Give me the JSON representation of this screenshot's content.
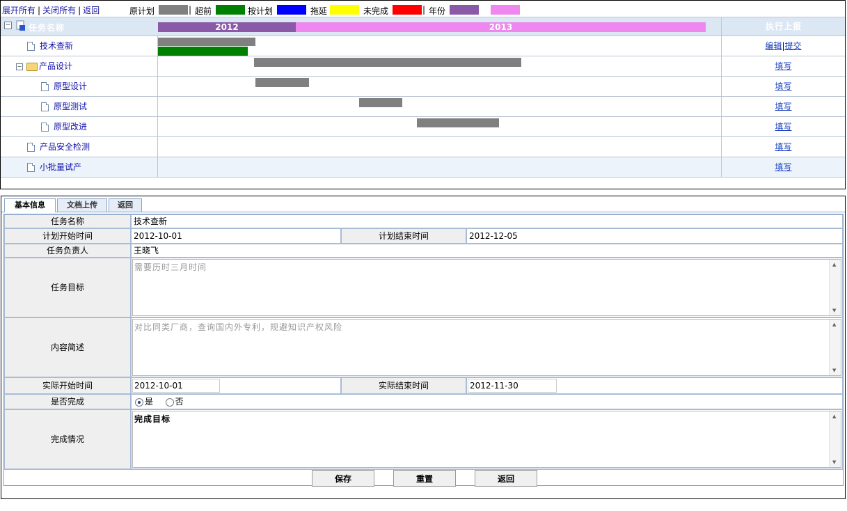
{
  "toolbar": {
    "expand_all": "展开所有",
    "collapse_all": "关闭所有",
    "back": "返回",
    "legend": [
      {
        "label": "原计划",
        "color": "#808080"
      },
      {
        "label": "超前",
        "color": "#008000"
      },
      {
        "label": "按计划",
        "color": "#0000ff"
      },
      {
        "label": "拖延",
        "color": "#ffff00"
      },
      {
        "label": "未完成",
        "color": "#ff0000"
      },
      {
        "label": "年份",
        "color": "#8a5aa8"
      },
      {
        "label": "",
        "color": "#ee88ee"
      }
    ]
  },
  "gantt": {
    "task_header": "任务名称",
    "report_header": "执行上报",
    "years": [
      {
        "label": "2012",
        "color": "#8a5aa8"
      },
      {
        "label": "2013",
        "color": "#ee88ee"
      }
    ],
    "rows": [
      {
        "name": "技术查新",
        "kind": "doc",
        "actions": [
          "编辑",
          "提交"
        ]
      },
      {
        "name": "产品设计",
        "kind": "folder",
        "actions": [
          "填写"
        ]
      },
      {
        "name": "原型设计",
        "kind": "doc",
        "actions": [
          "填写"
        ]
      },
      {
        "name": "原型测试",
        "kind": "doc",
        "actions": [
          "填写"
        ]
      },
      {
        "name": "原型改进",
        "kind": "doc",
        "actions": [
          "填写"
        ]
      },
      {
        "name": "产品安全检测",
        "kind": "doc",
        "actions": [
          "填写"
        ]
      },
      {
        "name": "小批量试产",
        "kind": "doc",
        "actions": [
          "填写"
        ]
      }
    ],
    "action_separator": "|"
  },
  "form": {
    "tabs": [
      "基本信息",
      "文档上传",
      "返回"
    ],
    "labels": {
      "task_name": "任务名称",
      "plan_start": "计划开始时间",
      "plan_end": "计划结束时间",
      "owner": "任务负责人",
      "goal": "任务目标",
      "summary": "内容简述",
      "actual_start": "实际开始时间",
      "actual_end": "实际结束时间",
      "completed": "是否完成",
      "status": "完成情况"
    },
    "values": {
      "task_name": "技术查新",
      "plan_start": "2012-10-01",
      "plan_end": "2012-12-05",
      "owner": "王晓飞",
      "goal": "需要历时三月时间",
      "summary": "对比同类厂商，查询国内外专利，规避知识产权风险",
      "actual_start": "2012-10-01",
      "actual_end": "2012-11-30",
      "status": "完成目标"
    },
    "radio": {
      "yes": "是",
      "no": "否",
      "selected": "yes"
    },
    "buttons": {
      "save": "保存",
      "reset": "重置",
      "back": "返回"
    }
  }
}
